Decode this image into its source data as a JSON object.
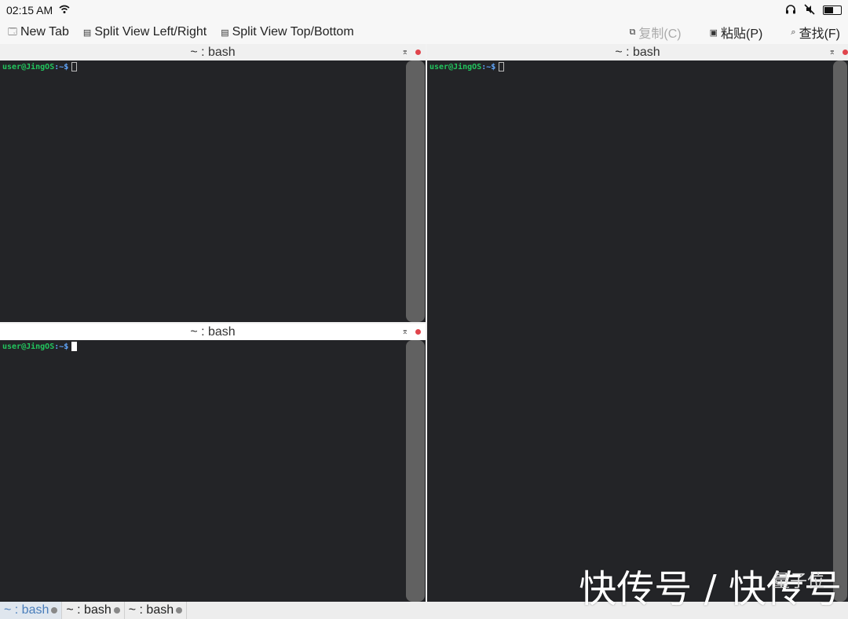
{
  "status": {
    "time": "02:15 AM",
    "battery_level": 0.5
  },
  "toolbar": {
    "new_tab": "New Tab",
    "split_lr": "Split View Left/Right",
    "split_tb": "Split View Top/Bottom",
    "copy": "复制(C)",
    "paste": "粘贴(P)",
    "find": "查找(F)"
  },
  "panes": {
    "top_left": {
      "title": "~ : bash",
      "user": "user@JingOS",
      "path": ":~$"
    },
    "bottom_left": {
      "title": "~ : bash",
      "user": "user@JingOS",
      "path": ":~$"
    },
    "right": {
      "title": "~ : bash",
      "user": "user@JingOS",
      "path": ":~$"
    }
  },
  "tabs": [
    {
      "label": "~ : bash"
    },
    {
      "label": "~ : bash"
    },
    {
      "label": "~ : bash"
    }
  ],
  "watermark": {
    "main": "快传号 / 快传号",
    "side": "量子位"
  }
}
